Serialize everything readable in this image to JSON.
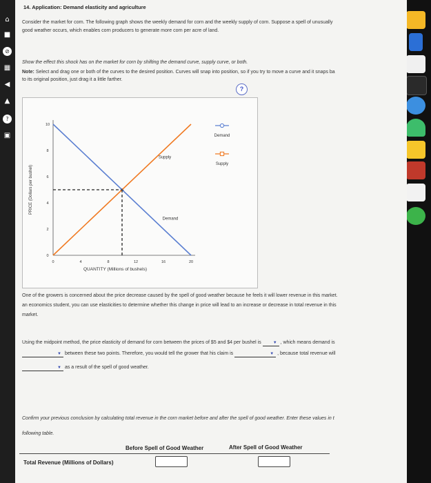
{
  "page": {
    "question_title": "14. Application: Demand elasticity and agriculture",
    "intro_line1": "Consider the market for corn. The following graph shows the weekly demand for corn and the weekly supply of corn. Suppose a spell of unusually",
    "intro_line2": "good weather occurs, which enables corn producers to generate more corn per acre of land.",
    "instruction": "Show the effect this shock has on the market for corn by shifting the demand curve, supply curve, or both.",
    "note_label": "Note:",
    "note_text": "Select and drag one or both of the curves to the desired position. Curves will snap into position, so if you try to move a curve and it snaps ba",
    "note_text2": "to its original position, just drag it a little farther.",
    "help_label": "?"
  },
  "chart_data": {
    "type": "line",
    "xlabel": "QUANTITY (Millions of bushels)",
    "ylabel": "PRICE (Dollars per bushel)",
    "xlim": [
      0,
      20
    ],
    "ylim": [
      0,
      10
    ],
    "xticks": [
      "0",
      "4",
      "8",
      "12",
      "16",
      "20"
    ],
    "yticks": [
      "0",
      "2",
      "4",
      "6",
      "8",
      "10"
    ],
    "series": [
      {
        "name": "Supply",
        "color": "#f07a22",
        "points": [
          [
            0,
            0
          ],
          [
            20,
            10
          ]
        ]
      },
      {
        "name": "Demand",
        "color": "#5b7fd1",
        "points": [
          [
            0,
            10
          ],
          [
            20,
            0
          ]
        ]
      }
    ],
    "equilibrium": {
      "x": 10,
      "y": 5
    },
    "curve_labels": {
      "supply": "Supply",
      "demand": "Demand"
    },
    "legend": [
      {
        "name": "Demand",
        "color": "#5b7fd1",
        "marker": "circle"
      },
      {
        "name": "Supply",
        "color": "#f07a22",
        "marker": "square"
      }
    ]
  },
  "growers": {
    "line1": "One of the growers is concerned about the price decrease caused by the spell of good weather because he feels it will lower revenue in this market.",
    "line2": "an economics student, you can use elasticities to determine whether this change in price will lead to an increase or decrease in total revenue in this",
    "line3": "market."
  },
  "midpoint": {
    "text1": "Using the midpoint method, the price elasticity of demand for corn between the prices of $5 and $4 per bushel is",
    "text2": ", which means demand is",
    "text3": "between these two points. Therefore, you would tell the grower that his claim is",
    "text4": ", because total revenue will",
    "text5": "as a result of the spell of good weather."
  },
  "confirm": {
    "line1": "Confirm your previous conclusion by calculating total revenue in the corn market before and after the spell of good weather. Enter these values in t",
    "line2": "following table."
  },
  "table": {
    "col_before": "Before Spell of Good Weather",
    "col_after": "After Spell of Good Weather",
    "row_label": "Total Revenue (Millions of Dollars)",
    "before_value": "",
    "after_value": ""
  }
}
